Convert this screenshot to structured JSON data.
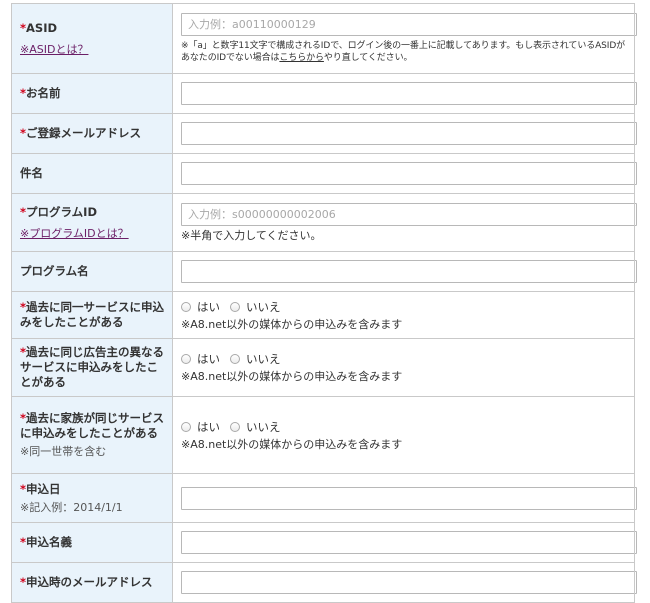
{
  "form": {
    "asid": {
      "label": "ASID",
      "required_mark": "*",
      "help_link": "※ASIDとは？",
      "placeholder": "入力例：a00110000129",
      "note_prefix": "※「a」と数字11文字で構成されるIDで、ログイン後の一番上に記載してあります。もし表示されているASIDがあなたのIDでない場合は",
      "note_link": "こちらから",
      "note_suffix": "やり直してください。"
    },
    "name": {
      "label": "お名前",
      "required_mark": "*"
    },
    "email": {
      "label": "ご登録メールアドレス",
      "required_mark": "*"
    },
    "subject": {
      "label": "件名"
    },
    "program_id": {
      "label": "プログラムID",
      "required_mark": "*",
      "help_link": "※プログラムIDとは？",
      "placeholder": "入力例：s00000000002006",
      "note": "※半角で入力してください。"
    },
    "program_name": {
      "label": "プログラム名"
    },
    "past_same_service": {
      "label": "過去に同一サービスに申込みをしたことがある",
      "required_mark": "*",
      "option_yes": "はい",
      "option_no": "いいえ",
      "note": "※A8.net以外の媒体からの申込みを含みます"
    },
    "past_same_advertiser": {
      "label": "過去に同じ広告主の異なるサービスに申込みをしたことがある",
      "required_mark": "*",
      "option_yes": "はい",
      "option_no": "いいえ",
      "note": "※A8.net以外の媒体からの申込みを含みます"
    },
    "past_family": {
      "label": "過去に家族が同じサービスに申込みをしたことがある",
      "required_mark": "*",
      "sub_note": "※同一世帯を含む",
      "option_yes": "はい",
      "option_no": "いいえ",
      "note": "※A8.net以外の媒体からの申込みを含みます"
    },
    "apply_date": {
      "label": "申込日",
      "required_mark": "*",
      "sub_note": "※記入例：2014/1/1"
    },
    "apply_name": {
      "label": "申込名義",
      "required_mark": "*"
    },
    "apply_email": {
      "label": "申込時のメールアドレス",
      "required_mark": "*"
    }
  }
}
